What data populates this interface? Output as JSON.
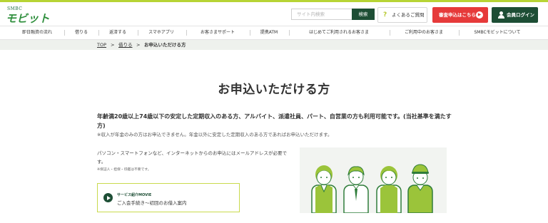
{
  "header": {
    "logo_small": "SMBC",
    "logo_main": "モビット",
    "search": {
      "placeholder": "サイト内検索",
      "button": "検索"
    },
    "faq_label": "よくあるご質問",
    "apply_label": "審査申込はこちら",
    "login_label": "会員ログイン"
  },
  "nav": {
    "items": [
      "即日融資の流れ",
      "借りる",
      "返済する",
      "スマホアプリ",
      "お客さまサポート",
      "提携ATM",
      "はじめてご利用されるお客さま",
      "ご利用中のお客さま",
      "SMBCモビットについて"
    ]
  },
  "breadcrumb": {
    "top": "TOP",
    "sep": ">",
    "parent": "借りる",
    "current": "お申込いただける方"
  },
  "main": {
    "title": "お申込いただける方",
    "condition": "年齢満20歳以上74歳以下の安定した定期収入のある方、アルバイト、派遣社員、パート、自営業の方も利用可能です。(当社基準を満たす方)",
    "note1": "※収入が年金のみの方はお申込できません。年金以外に安定した定期収入のある方であればお申込いただけます。",
    "description": "パソコン・スマートフォンなど、インターネットからのお申込にはメールアドレスが必要です。",
    "note2": "※保証人・担保・印鑑は不要です。",
    "movie": {
      "label": "サービス紹介MOVIE",
      "title": "ご入会手続き～初回のお借入案内"
    }
  },
  "colors": {
    "brand_green": "#1d4e35",
    "accent_lime": "#b7d435",
    "apply_red": "#e63a3a",
    "breadcrumb_bg": "#eef1ed"
  },
  "icons": [
    "question-icon",
    "arrow-circle-icon",
    "user-icon",
    "play-icon"
  ]
}
